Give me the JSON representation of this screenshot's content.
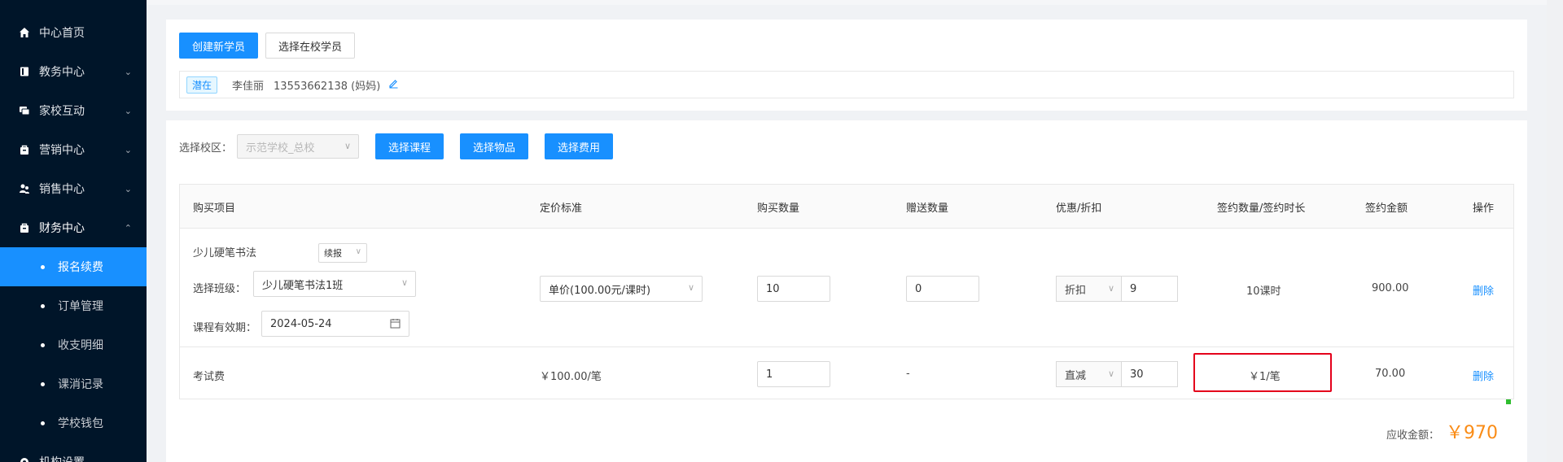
{
  "sidebar": {
    "items": [
      {
        "label": "中心首页",
        "icon": "home-icon",
        "has_arrow": false
      },
      {
        "label": "教务中心",
        "icon": "book-icon",
        "has_arrow": true
      },
      {
        "label": "家校互动",
        "icon": "chat-icon",
        "has_arrow": true
      },
      {
        "label": "营销中心",
        "icon": "bag-icon",
        "has_arrow": true
      },
      {
        "label": "销售中心",
        "icon": "users-icon",
        "has_arrow": true
      },
      {
        "label": "财务中心",
        "icon": "bag-icon",
        "has_arrow": true,
        "open": true
      }
    ],
    "sub_items": [
      {
        "label": "报名续费",
        "active": true
      },
      {
        "label": "订单管理"
      },
      {
        "label": "收支明细"
      },
      {
        "label": "课消记录"
      },
      {
        "label": "学校钱包"
      }
    ],
    "bottom_item": {
      "label": "机构设置",
      "icon": "gear-icon"
    },
    "bg_color": "#001529",
    "active_color": "#1890ff"
  },
  "student": {
    "create_button": "创建新学员",
    "select_button": "选择在校学员",
    "tag": "潜在",
    "name": "李佳丽",
    "phone": "13553662138 (妈妈)",
    "edit_icon": "edit-icon"
  },
  "toolbar": {
    "campus_label": "选择校区：",
    "campus_value": "示范学校_总校",
    "btn_course": "选择课程",
    "btn_goods": "选择物品",
    "btn_fee": "选择费用"
  },
  "table": {
    "headers": [
      "购买项目",
      "定价标准",
      "购买数量",
      "赠送数量",
      "优惠/折扣",
      "签约数量/签约时长",
      "签约金额",
      "操作"
    ],
    "row1": {
      "item": "少儿硬笔书法",
      "type_select": "续报",
      "class_label": "选择班级：",
      "class_value": "少儿硬笔书法1班",
      "valid_label": "课程有效期：",
      "valid_value": "2024-05-24",
      "price_select": "单价(100.00元/课时)",
      "qty": "10",
      "gift": "0",
      "discount_type": "折扣",
      "discount_value": "9",
      "contract": "10课时",
      "amount": "900.00",
      "action": "删除"
    },
    "row2": {
      "item": "考试费",
      "price": "￥100.00/笔",
      "qty": "1",
      "gift": "-",
      "discount_type": "直减",
      "discount_value": "30",
      "contract": "￥1/笔",
      "amount": "70.00",
      "action": "删除"
    }
  },
  "total": {
    "label": "应收金额：",
    "value": "￥970",
    "color": "#fa8c16"
  },
  "accent_color": "#1890ff"
}
